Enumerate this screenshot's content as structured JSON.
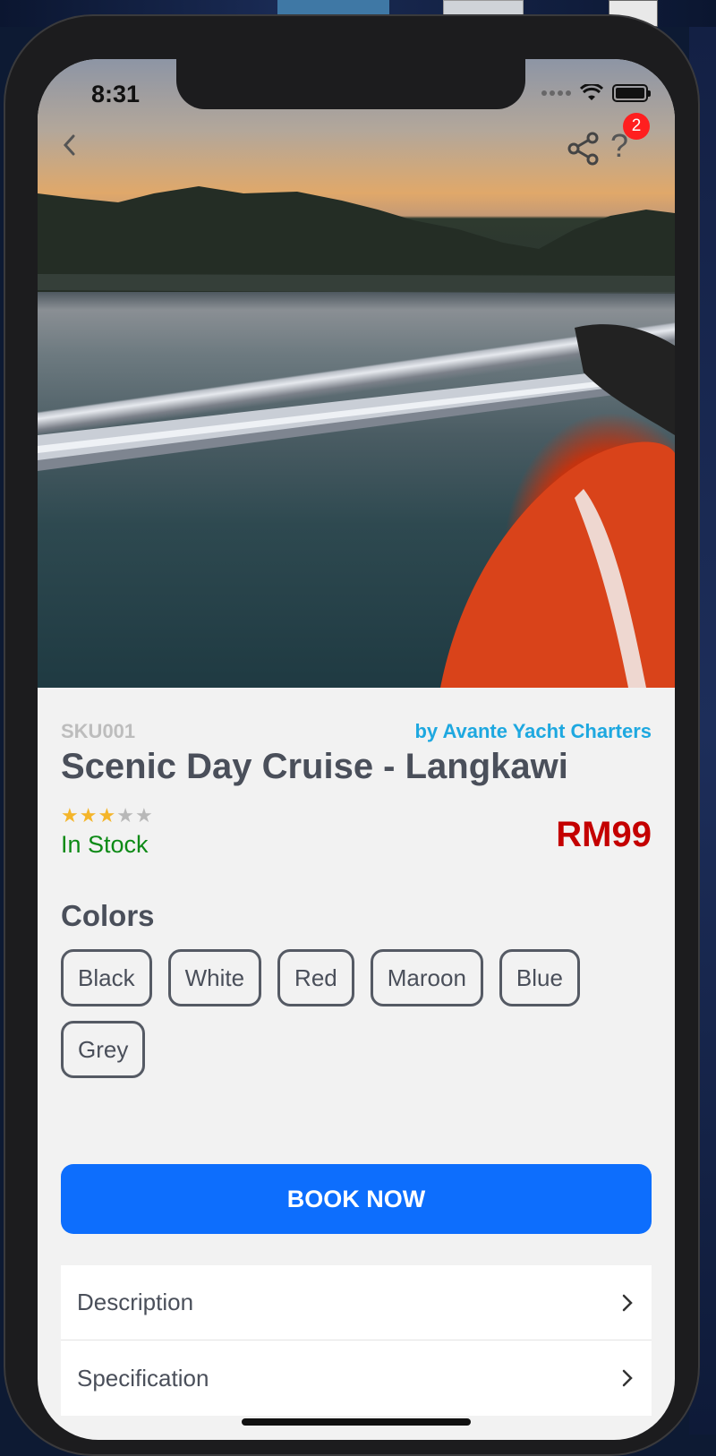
{
  "status_bar": {
    "time": "8:31"
  },
  "header": {
    "badge_count": "2",
    "help_glyph": "?"
  },
  "product": {
    "sku": "SKU001",
    "vendor": "by Avante Yacht Charters",
    "title": "Scenic Day Cruise - Langkawi",
    "rating": 3,
    "rating_max": 5,
    "stock": "In Stock",
    "price": "RM99"
  },
  "colors": {
    "heading": "Colors",
    "options": [
      "Black",
      "White",
      "Red",
      "Maroon",
      "Blue",
      "Grey"
    ]
  },
  "actions": {
    "book_label": "BOOK NOW"
  },
  "details": {
    "items": [
      {
        "label": "Description"
      },
      {
        "label": "Specification"
      }
    ]
  },
  "icons": {
    "back": "chevron-left-icon",
    "share": "share-icon",
    "help": "question-icon",
    "wifi": "wifi-icon",
    "battery": "battery-icon",
    "row_chevron": "chevron-right-icon"
  },
  "theme": {
    "accent": "#0d6efd",
    "price_color": "#c40000",
    "stock_color": "#0d8a16",
    "vendor_color": "#1ea8e0",
    "star_color": "#f4b52a"
  }
}
